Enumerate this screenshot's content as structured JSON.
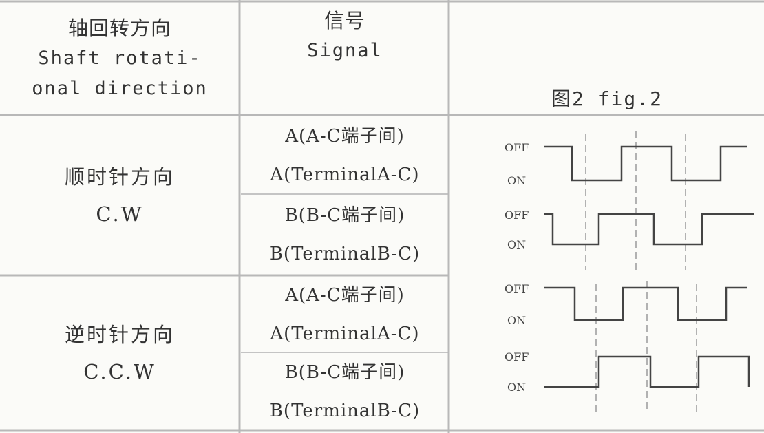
{
  "header": {
    "col1_lines": [
      "轴回转方向",
      "Shaft rotati-",
      "onal direction"
    ],
    "col2_lines": [
      "信号",
      "Signal"
    ],
    "col3_caption": "图2 fig.2"
  },
  "rows": [
    {
      "direction_lines": [
        "顺时针方向",
        "C.W"
      ],
      "signals": [
        {
          "lines": [
            "A(A-C端子间)",
            "A(TerminalA-C)"
          ]
        },
        {
          "lines": [
            "B(B-C端子间)",
            "B(TerminalB-C)"
          ]
        }
      ]
    },
    {
      "direction_lines": [
        "逆时针方向",
        "C.C.W"
      ],
      "signals": [
        {
          "lines": [
            "A(A-C端子间)",
            "A(TerminalA-C)"
          ]
        },
        {
          "lines": [
            "B(B-C端子间)",
            "B(TerminalB-C)"
          ]
        }
      ]
    }
  ],
  "waveform_labels": {
    "high": "OFF",
    "low": "ON"
  },
  "colors": {
    "rule": "#b8b8b8",
    "ink": "#444444",
    "dash": "#9a9a9a",
    "background": "#fbfbf8"
  }
}
